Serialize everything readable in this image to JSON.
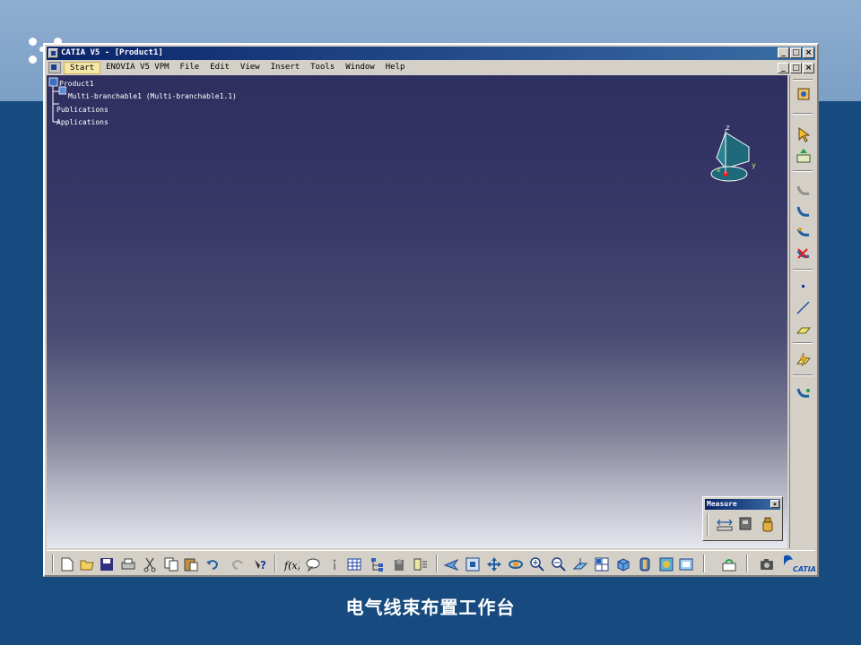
{
  "window": {
    "title": "CATIA V5 - [Product1]",
    "min": "_",
    "max": "□",
    "close": "×"
  },
  "menu": {
    "items": [
      "Start",
      "ENOVIA V5 VPM",
      "File",
      "Edit",
      "View",
      "Insert",
      "Tools",
      "Window",
      "Help"
    ]
  },
  "tree": {
    "root": "Product1",
    "child": "Multi-branchable1 (Multi-branchable1.1)",
    "publications": "Publications",
    "applications": "Applications"
  },
  "compass": {
    "z": "z",
    "y": "y",
    "x": "x"
  },
  "measure": {
    "title": "Measure",
    "close": "×"
  },
  "caption": "电气线束布置工作台",
  "colors": {
    "title_bar": "#0a246a",
    "viewport_top": "#2e2f60",
    "viewport_bottom": "#e6e6ee",
    "slide_bg": "#174a7f",
    "menu_highlight": "#f4e6a6"
  },
  "icons": {
    "right_toolbar": [
      "product-icon",
      "select-arrow-icon",
      "export-icon",
      "harness-icon",
      "branch-icon",
      "route-icon",
      "delete-branch-icon",
      "point-icon",
      "line-icon",
      "plane-icon",
      "flash-icon",
      "bundle-icon"
    ],
    "bottom_toolbar": [
      "new-icon",
      "open-icon",
      "save-icon",
      "print-icon",
      "cut-icon",
      "copy-icon",
      "paste-icon",
      "undo-icon",
      "redo-icon",
      "help-icon",
      "formula-icon",
      "comment-icon",
      "info-icon",
      "table-icon",
      "tree-icon",
      "catalog-icon",
      "knowledge-icon",
      "fly-icon",
      "fit-all-icon",
      "pan-icon",
      "rotate-icon",
      "zoom-in-icon",
      "zoom-out-icon",
      "normal-view-icon",
      "multi-view-icon",
      "iso-view-icon",
      "shading-icon",
      "hide-show-icon",
      "swap-icon",
      "update-icon",
      "capture-icon",
      "catia-logo"
    ]
  }
}
